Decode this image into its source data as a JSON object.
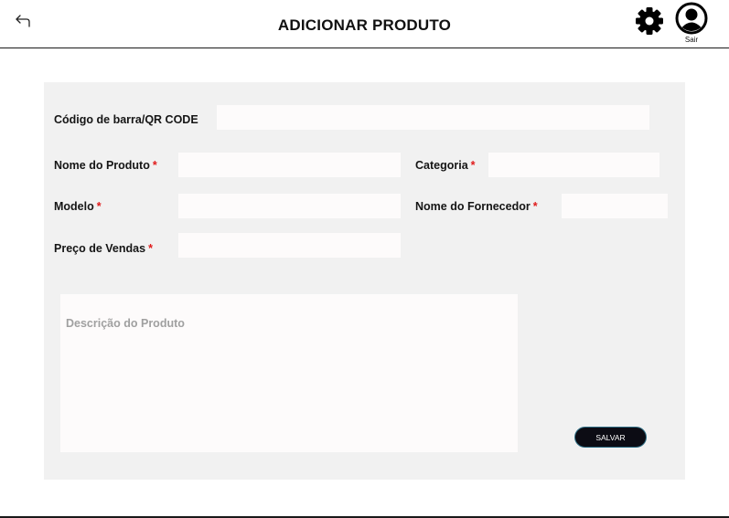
{
  "header": {
    "title": "ADICIONAR PRODUTO",
    "logout_label": "Sair",
    "icons": {
      "back": "back-arrow-icon",
      "settings": "gear-icon",
      "user": "user-icon"
    }
  },
  "form": {
    "barcode": {
      "label": "Código de barra/QR CODE",
      "value": ""
    },
    "product_name": {
      "label": "Nome do Produto",
      "required_mark": "*",
      "value": ""
    },
    "category": {
      "label": "Categoria",
      "required_mark": "*",
      "value": ""
    },
    "model": {
      "label": "Modelo",
      "required_mark": "*",
      "value": ""
    },
    "supplier_name": {
      "label": "Nome do Fornecedor",
      "required_mark": "*",
      "value": ""
    },
    "sale_price": {
      "label": "Preço de Vendas",
      "required_mark": "*",
      "value": ""
    },
    "description": {
      "placeholder": "Descrição do Produto",
      "value": ""
    },
    "save_label": "SALVAR"
  },
  "colors": {
    "panel_bg": "#f1f1f1",
    "field_bg": "#fdfbfb",
    "required": "#e01b1b",
    "button_bg": "#0c0c14",
    "button_border": "#2f6f86"
  }
}
